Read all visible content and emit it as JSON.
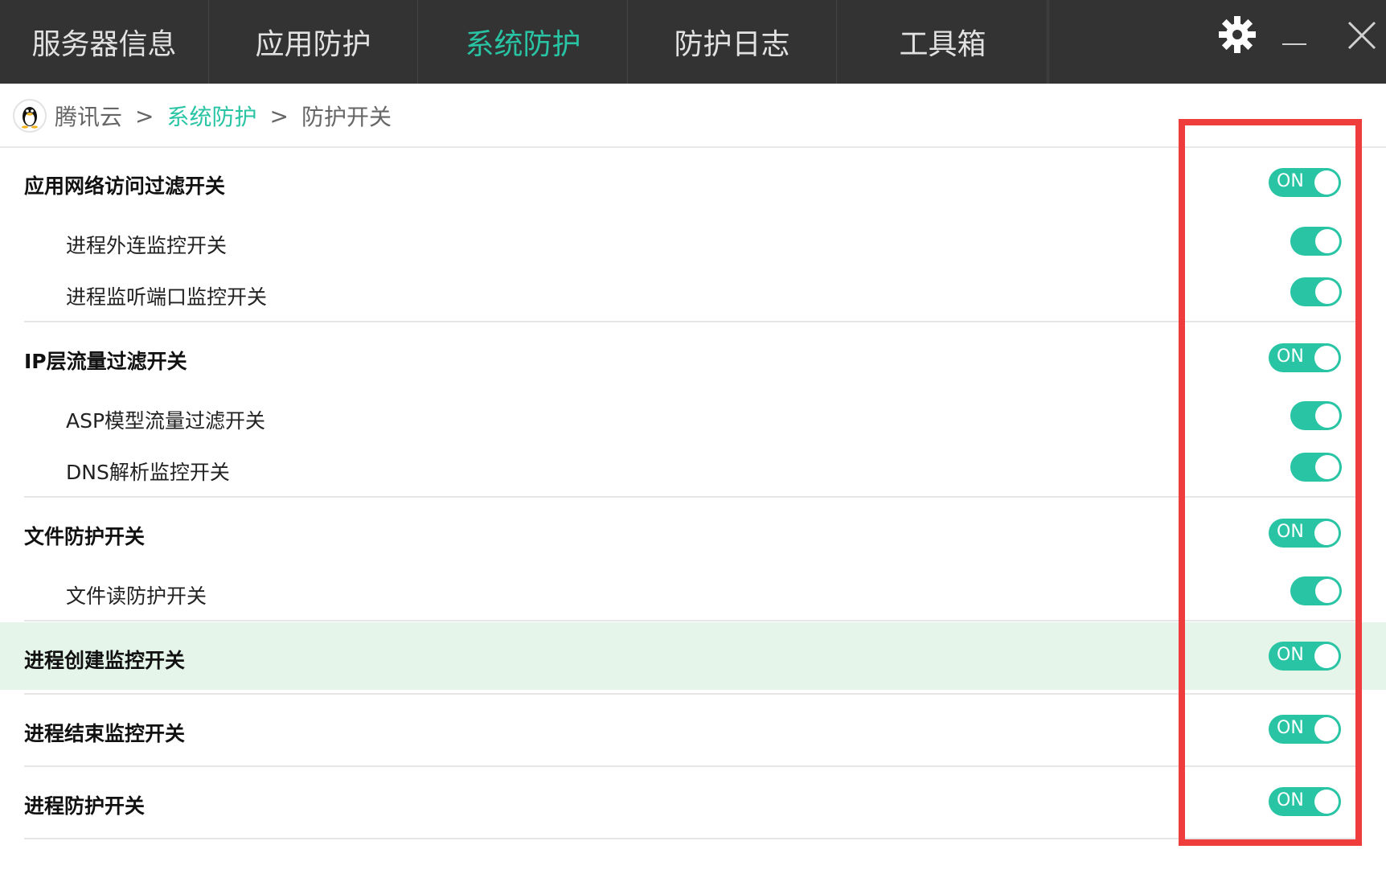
{
  "tabs": [
    {
      "label": "服务器信息",
      "active": false
    },
    {
      "label": "应用防护",
      "active": false
    },
    {
      "label": "系统防护",
      "active": true
    },
    {
      "label": "防护日志",
      "active": false
    },
    {
      "label": "工具箱",
      "active": false
    }
  ],
  "window_controls": {
    "settings_icon": "gear-icon",
    "minimize_icon": "minimize-icon",
    "close_icon": "close-icon"
  },
  "breadcrumb": {
    "logo_icon": "qq-penguin-icon",
    "root": "腾讯云",
    "sep1": ">",
    "section": "系统防护",
    "sep2": ">",
    "current": "防护开关"
  },
  "settings": {
    "group_app": {
      "label": "应用网络访问过滤开关",
      "toggle_text": "ON",
      "children": [
        {
          "label": "进程外连监控开关"
        },
        {
          "label": "进程监听端口监控开关"
        }
      ]
    },
    "group_ip": {
      "label": "IP层流量过滤开关",
      "toggle_text": "ON",
      "children": [
        {
          "label": "ASP模型流量过滤开关"
        },
        {
          "label": "DNS解析监控开关"
        }
      ]
    },
    "group_file": {
      "label": "文件防护开关",
      "toggle_text": "ON",
      "children": [
        {
          "label": "文件读防护开关"
        }
      ]
    },
    "proc_create": {
      "label": "进程创建监控开关",
      "toggle_text": "ON"
    },
    "proc_end": {
      "label": "进程结束监控开关",
      "toggle_text": "ON"
    },
    "proc_protect": {
      "label": "进程防护开关",
      "toggle_text": "ON"
    }
  },
  "colors": {
    "accent": "#28c4a4",
    "topbar_bg": "#333333",
    "highlight_row": "#e6f5ea",
    "annotation_red": "#ef3d3d"
  }
}
